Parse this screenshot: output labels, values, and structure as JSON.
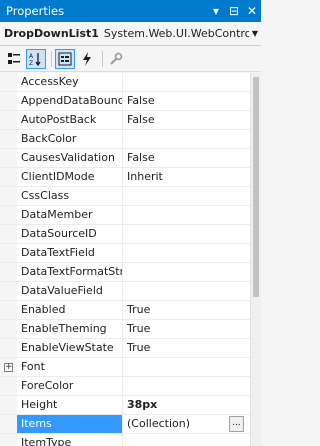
{
  "panel": {
    "title": "Properties",
    "pin_glyph": "▾",
    "dock_glyph": "⊟",
    "close_glyph": "✕"
  },
  "object_selector": {
    "name": "DropDownList1",
    "type": "System.Web.UI.WebContro",
    "arrow_glyph": "▼"
  },
  "toolbar": {
    "buttons": [
      {
        "icon": "categorized-icon",
        "active": false
      },
      {
        "icon": "alphabetical-icon",
        "active": true
      },
      {
        "icon": "properties-icon",
        "active": true
      },
      {
        "icon": "events-icon",
        "active": false
      },
      {
        "icon": "property-pages-icon",
        "active": false
      }
    ]
  },
  "properties": [
    {
      "name": "AccessKey",
      "value": ""
    },
    {
      "name": "AppendDataBound",
      "value": "False"
    },
    {
      "name": "AutoPostBack",
      "value": "False"
    },
    {
      "name": "BackColor",
      "value": ""
    },
    {
      "name": "CausesValidation",
      "value": "False"
    },
    {
      "name": "ClientIDMode",
      "value": "Inherit"
    },
    {
      "name": "CssClass",
      "value": ""
    },
    {
      "name": "DataMember",
      "value": ""
    },
    {
      "name": "DataSourceID",
      "value": ""
    },
    {
      "name": "DataTextField",
      "value": ""
    },
    {
      "name": "DataTextFormatStri",
      "value": ""
    },
    {
      "name": "DataValueField",
      "value": ""
    },
    {
      "name": "Enabled",
      "value": "True"
    },
    {
      "name": "EnableTheming",
      "value": "True"
    },
    {
      "name": "EnableViewState",
      "value": "True"
    },
    {
      "name": "Font",
      "value": "",
      "expander": "+"
    },
    {
      "name": "ForeColor",
      "value": ""
    },
    {
      "name": "Height",
      "value": "38px",
      "bold": true
    },
    {
      "name": "Items",
      "value": "(Collection)",
      "selected": true,
      "button": "..."
    },
    {
      "name": "ItemType",
      "value": ""
    }
  ],
  "colors": {
    "title_bg": "#007acc",
    "selection_bg": "#3399ff"
  }
}
